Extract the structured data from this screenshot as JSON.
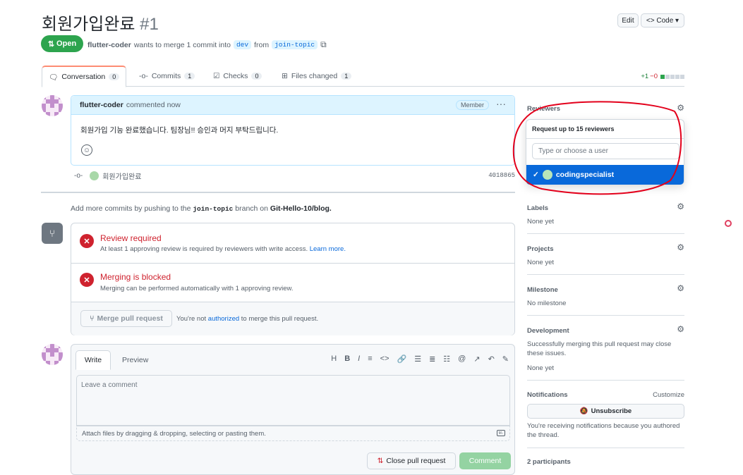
{
  "header": {
    "title": "회원가입완료",
    "number": "#1",
    "edit_label": "Edit",
    "code_label": "<> Code ▾"
  },
  "status": {
    "badge": "Open",
    "author": "flutter-coder",
    "text1": "wants to merge 1 commit into",
    "base_branch": "dev",
    "text2": "from",
    "head_branch": "join-topic"
  },
  "tabs": [
    {
      "label": "Conversation",
      "count": "0"
    },
    {
      "label": "Commits",
      "count": "1"
    },
    {
      "label": "Checks",
      "count": "0"
    },
    {
      "label": "Files changed",
      "count": "1"
    }
  ],
  "diffstat": {
    "add": "+1",
    "del": "−0"
  },
  "comment": {
    "author": "flutter-coder",
    "action": "commented now",
    "role": "Member",
    "body": "회원가입 기능 완료했습니다. 팀장님!! 승인과 머지 부탁드립니다.",
    "commit_message": "회원가입완료",
    "commit_sha": "4018865"
  },
  "add_more": {
    "prefix": "Add more commits by pushing to the",
    "branch": "join-topic",
    "mid": "branch on",
    "repo": "Git-Hello-10/blog."
  },
  "merge": {
    "review_title": "Review required",
    "review_sub": "At least 1 approving review is required by reviewers with write access.",
    "learn_more": "Learn more.",
    "blocked_title": "Merging is blocked",
    "blocked_sub": "Merging can be performed automatically with 1 approving review.",
    "merge_button": "Merge pull request",
    "not_auth_prefix": "You're not",
    "authorized": "authorized",
    "not_auth_suffix": "to merge this pull request."
  },
  "editor": {
    "write_tab": "Write",
    "preview_tab": "Preview",
    "placeholder": "Leave a comment",
    "attach_text": "Attach files by dragging & dropping, selecting or pasting them.",
    "close_button": "Close pull request",
    "comment_button": "Comment"
  },
  "sidebar": {
    "reviewers_label": "Reviewers",
    "popup_title": "Request up to 15 reviewers",
    "popup_placeholder": "Type or choose a user",
    "selected_user": "codingspecialist",
    "labels_label": "Labels",
    "labels_val": "None yet",
    "projects_label": "Projects",
    "projects_val": "None yet",
    "milestone_label": "Milestone",
    "milestone_val": "No milestone",
    "development_label": "Development",
    "development_desc": "Successfully merging this pull request may close these issues.",
    "development_val": "None yet",
    "notifications_label": "Notifications",
    "customize": "Customize",
    "unsubscribe": "Unsubscribe",
    "notif_desc": "You're receiving notifications because you authored the thread.",
    "participants": "2 participants"
  },
  "colors": {
    "open": "#2da44e",
    "blocked": "#cf222e",
    "selected": "#0969da",
    "annotation": "#e3001b"
  }
}
